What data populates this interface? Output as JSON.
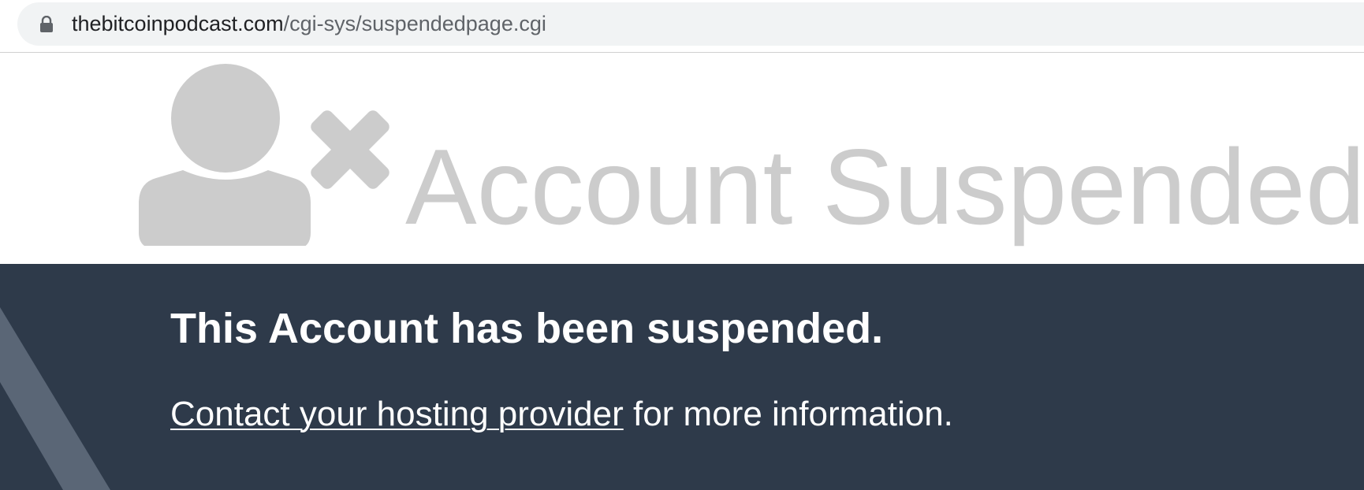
{
  "browser": {
    "url_host": "thebitcoinpodcast.com",
    "url_path": "/cgi-sys/suspendedpage.cgi",
    "lock_icon": "lock-icon"
  },
  "hero": {
    "icon": "user-remove-icon",
    "title": "Account Suspended",
    "title_color": "#cccccc"
  },
  "message": {
    "heading": "This Account has been suspended.",
    "link_text": "Contact your hosting provider",
    "trailing_text": " for more information.",
    "panel_color": "#2e3a4a"
  }
}
